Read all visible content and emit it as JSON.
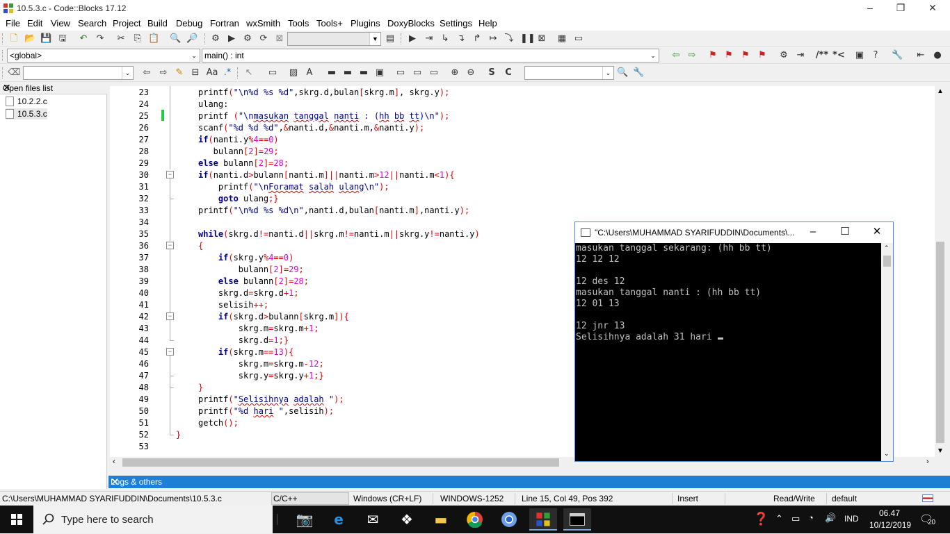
{
  "window": {
    "title": "10.5.3.c - Code::Blocks 17.12",
    "controls": {
      "minimize": "–",
      "restore": "❐",
      "close": "✕"
    }
  },
  "menu": [
    "File",
    "Edit",
    "View",
    "Search",
    "Project",
    "Build",
    "Debug",
    "Fortran",
    "wxSmith",
    "Tools",
    "Tools+",
    "Plugins",
    "DoxyBlocks",
    "Settings",
    "Help"
  ],
  "toolbar": {
    "scope_combo": "<global>",
    "function_combo": "main() : int",
    "doxy_comment": "/**",
    "doxy_inline": "*<"
  },
  "open_files": {
    "title": "Open files list",
    "close": "✕",
    "files": [
      "10.2.2.c",
      "10.5.3.c"
    ]
  },
  "editor": {
    "line_numbers": [
      "23",
      "24",
      "25",
      "26",
      "27",
      "28",
      "29",
      "30",
      "31",
      "32",
      "33",
      "34",
      "35",
      "36",
      "37",
      "38",
      "39",
      "40",
      "41",
      "42",
      "43",
      "44",
      "45",
      "46",
      "47",
      "48",
      "49",
      "50",
      "51",
      "52",
      "53"
    ]
  },
  "console": {
    "title": "\"C:\\Users\\MUHAMMAD SYARIFUDDIN\\Documents\\...",
    "lines": [
      "masukan tanggal sekarang: (hh bb tt)",
      "12 12 12",
      "",
      "12 des 12",
      "masukan tanggal nanti : (hh bb tt)",
      "12 01 13",
      "",
      "12 jnr 13",
      "Selisihnya adalah 31 hari "
    ]
  },
  "logs": {
    "title": "Logs & others",
    "close": "✕"
  },
  "status": {
    "path": "C:\\Users\\MUHAMMAD SYARIFUDDIN\\Documents\\10.5.3.c",
    "language": "C/C++",
    "eol": "Windows (CR+LF)",
    "encoding": "WINDOWS-1252",
    "position": "Line 15, Col 49, Pos 392",
    "mode": "Insert",
    "access": "Read/Write",
    "profile": "default"
  },
  "taskbar": {
    "search_placeholder": "Type here to search",
    "language": "IND",
    "time": "06.47",
    "date": "10/12/2019",
    "notifications": "20"
  },
  "colors": {
    "keyword": "#00008b",
    "number": "#e000e0",
    "operator": "#e00000",
    "logs_bar": "#1e7fd6",
    "taskbar": "#101010"
  }
}
